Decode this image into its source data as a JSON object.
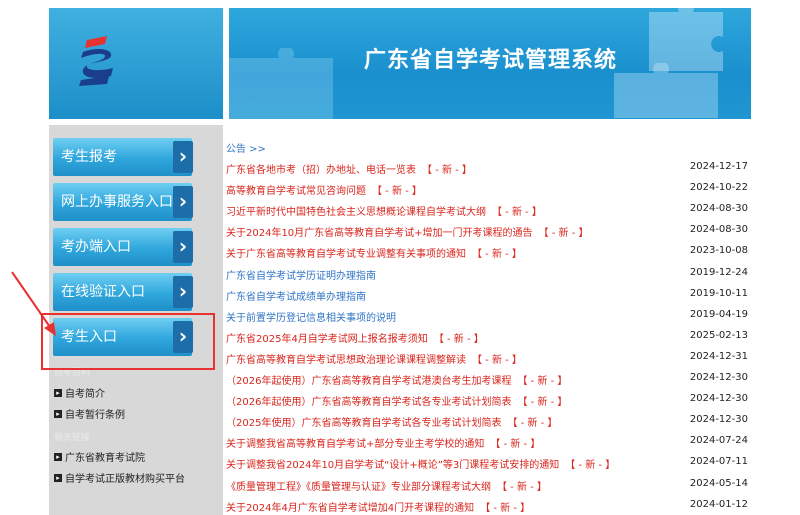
{
  "header": {
    "title": "广东省自学考试管理系统"
  },
  "sidebar": {
    "nav": [
      {
        "label": "考生报考"
      },
      {
        "label": "网上办事服务入口"
      },
      {
        "label": "考办端入口"
      },
      {
        "label": "在线验证入口"
      },
      {
        "label": "考生入口"
      }
    ],
    "section1": "自考百科",
    "links1": [
      {
        "label": "自考简介"
      },
      {
        "label": "自考暂行条例"
      }
    ],
    "section2": "相关链接",
    "links2": [
      {
        "label": "广东省教育考试院"
      },
      {
        "label": "自学考试正版教材购买平台"
      }
    ]
  },
  "notices": {
    "heading": "公告 >>",
    "new_tag": "【 - 新 - 】",
    "items": [
      {
        "title": "广东省各地市考（招）办地址、电话一览表",
        "date": "2024-12-17",
        "color": "red",
        "new": true
      },
      {
        "title": "高等教育自学考试常见咨询问题",
        "date": "2024-10-22",
        "color": "red",
        "new": true
      },
      {
        "title": "习近平新时代中国特色社会主义思想概论课程自学考试大纲",
        "date": "2024-08-30",
        "color": "red",
        "new": true
      },
      {
        "title": "关于2024年10月广东省高等教育自学考试+增加一门开考课程的通告",
        "date": "2024-08-30",
        "color": "red",
        "new": true
      },
      {
        "title": "关于广东省高等教育自学考试专业调整有关事项的通知",
        "date": "2023-10-08",
        "color": "red",
        "new": true
      },
      {
        "title": "广东省自学考试学历证明办理指南",
        "date": "2019-12-24",
        "color": "blue",
        "new": false
      },
      {
        "title": "广东省自学考试成绩单办理指南",
        "date": "2019-10-11",
        "color": "blue",
        "new": false
      },
      {
        "title": "关于前置学历登记信息相关事项的说明",
        "date": "2019-04-19",
        "color": "blue",
        "new": false
      },
      {
        "title": "广东省2025年4月自学考试网上报名报考须知",
        "date": "2025-02-13",
        "color": "red",
        "new": true
      },
      {
        "title": "广东省高等教育自学考试思想政治理论课课程调整解读",
        "date": "2024-12-31",
        "color": "red",
        "new": true
      },
      {
        "title": "（2026年起使用）广东省高等教育自学考试港澳台考生加考课程",
        "date": "2024-12-30",
        "color": "red",
        "new": true
      },
      {
        "title": "（2026年起使用）广东省高等教育自学考试各专业考试计划简表",
        "date": "2024-12-30",
        "color": "red",
        "new": true
      },
      {
        "title": "（2025年使用）广东省高等教育自学考试各专业考试计划简表",
        "date": "2024-12-30",
        "color": "red",
        "new": true
      },
      {
        "title": "关于调整我省高等教育自学考试+部分专业主考学校的通知",
        "date": "2024-07-24",
        "color": "red",
        "new": true
      },
      {
        "title": "关于调整我省2024年10月自学考试“设计+概论”等3门课程考试安排的通知",
        "date": "2024-07-11",
        "color": "red",
        "new": true
      },
      {
        "title": "《质量管理工程》《质量管理与认证》专业部分课程考试大纲",
        "date": "2024-05-14",
        "color": "red",
        "new": true
      },
      {
        "title": "关于2024年4月广东省自学考试增加4门开考课程的通知",
        "date": "2024-01-12",
        "color": "red",
        "new": true
      }
    ]
  },
  "colors": {
    "banner": "#1a8fce",
    "nav_button": "#2fa6dc",
    "accent_red": "#d9251d",
    "link_blue": "#2f74c6",
    "highlight": "#e8322f"
  }
}
